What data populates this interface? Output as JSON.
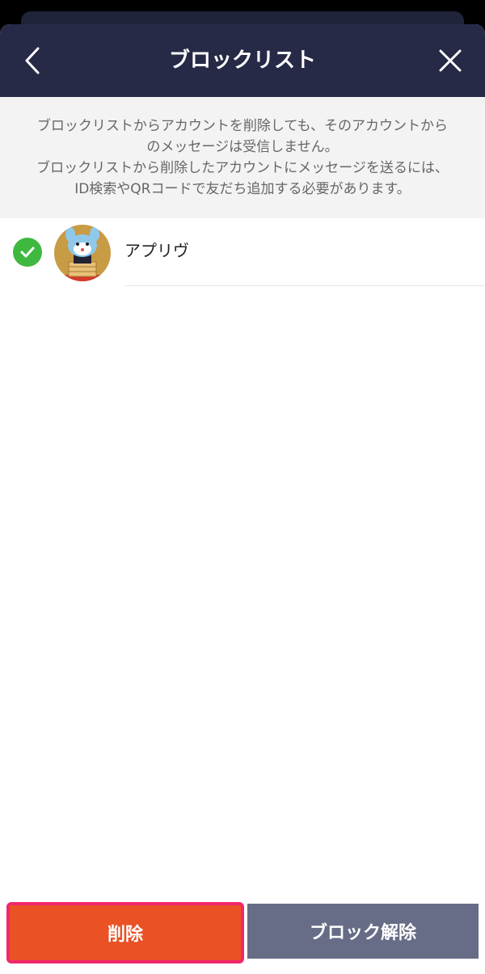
{
  "header": {
    "title": "ブロックリスト",
    "back_icon": "chevron-left-icon",
    "close_icon": "close-icon",
    "background_color": "#262a47"
  },
  "notice": {
    "lines": [
      "ブロックリストからアカウントを削除しても、そのアカウントから",
      "のメッセージは受信しません。",
      "ブロックリストから削除したアカウントにメッセージを送るには、",
      "ID検索やQRコードで友だち追加する必要があります。"
    ]
  },
  "list": {
    "items": [
      {
        "name": "アプリヴ",
        "selected": true,
        "avatar_icon": "mascot-avatar-icon",
        "check_icon": "check-circle-icon"
      }
    ]
  },
  "footer": {
    "delete_label": "削除",
    "unblock_label": "ブロック解除",
    "delete_color": "#ea5125",
    "unblock_color": "#676d86",
    "highlight_color": "#f0286a"
  }
}
